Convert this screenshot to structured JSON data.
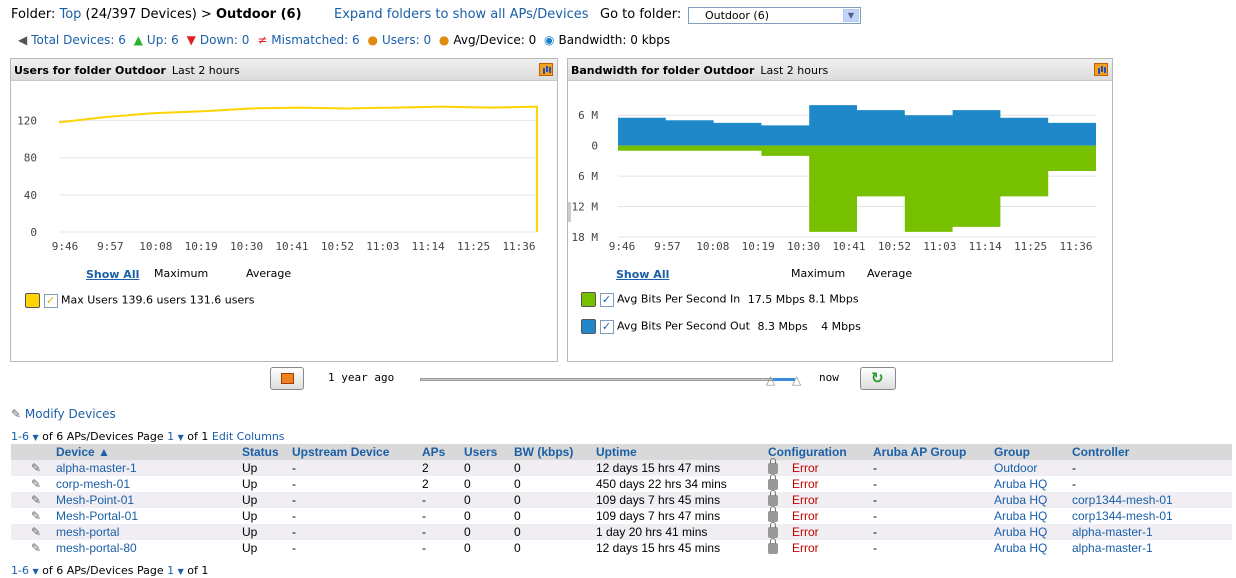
{
  "header": {
    "folder_label": "Folder:",
    "top_link": "Top",
    "top_count": "(24/397 Devices) >",
    "current_folder": "Outdoor (6)",
    "expand_link": "Expand folders to show all APs/Devices",
    "goto_label": "Go to folder:",
    "goto_value": "Outdoor (6)"
  },
  "stats": {
    "total": "Total Devices: 6",
    "up": "Up: 6",
    "down": "Down: 0",
    "mismatched": "Mismatched: 6",
    "users": "Users: 0",
    "avg": "Avg/Device: 0",
    "bandwidth": "Bandwidth: 0 kbps"
  },
  "users_panel": {
    "title": "Users for folder Outdoor",
    "range": "Last 2 hours",
    "show_all": "Show All",
    "col_max": "Maximum",
    "col_avg": "Average",
    "series_label": "Max Users",
    "series_max": "139.6 users",
    "series_avg": "131.6 users",
    "color": "#ffd400"
  },
  "bw_panel": {
    "title": "Bandwidth for folder Outdoor",
    "range": "Last 2 hours",
    "show_all": "Show All",
    "col_max": "Maximum",
    "col_avg": "Average",
    "in_label": "Avg Bits Per Second In",
    "in_max": "17.5 Mbps",
    "in_avg": "8.1 Mbps",
    "out_label": "Avg Bits Per Second Out",
    "out_max": "8.3 Mbps",
    "out_avg": "4 Mbps",
    "in_color": "#77c000",
    "out_color": "#1e88c8"
  },
  "slider": {
    "left_label": "1 year ago",
    "right_label": "now"
  },
  "chart_data": [
    {
      "type": "line",
      "x": [
        "9:46",
        "9:57",
        "10:08",
        "10:19",
        "10:30",
        "10:41",
        "10:52",
        "11:03",
        "11:14",
        "11:25",
        "11:36"
      ],
      "series": [
        {
          "name": "Max Users",
          "values": [
            118,
            124,
            128,
            130,
            133,
            134,
            133,
            134,
            135,
            134,
            135
          ]
        }
      ],
      "ylim": [
        0,
        140
      ],
      "yticks": [
        0,
        40,
        80,
        120
      ]
    },
    {
      "type": "area",
      "x": [
        "9:46",
        "9:57",
        "10:08",
        "10:19",
        "10:30",
        "10:41",
        "10:52",
        "11:03",
        "11:14",
        "11:25",
        "11:36"
      ],
      "series": [
        {
          "name": "Avg Bits Per Second Out",
          "values": [
            5.5,
            5,
            4.5,
            4,
            8,
            7,
            6,
            7,
            5.5,
            4.5,
            3.5
          ]
        },
        {
          "name": "Avg Bits Per Second In",
          "values": [
            -1,
            -1,
            -1,
            -2,
            -17,
            -10,
            -17,
            -16,
            -10,
            -5,
            -1
          ]
        }
      ],
      "ylim": [
        -18,
        9
      ],
      "ytick_labels": [
        "6 M",
        "0",
        "6 M",
        "12 M",
        "18 M"
      ]
    }
  ],
  "table": {
    "pager_top_range": "1-6",
    "pager_top_text": "of 6 APs/Devices  Page",
    "pager_page": "1",
    "pager_of": "of 1",
    "edit_columns": "Edit Columns",
    "pager_bottom_range": "1-6",
    "modify": "Modify Devices",
    "columns": [
      "Device ▲",
      "Status",
      "Upstream Device",
      "APs",
      "Users",
      "BW (kbps)",
      "Uptime",
      "Configuration",
      "Aruba AP Group",
      "Group",
      "Controller"
    ],
    "rows": [
      [
        "alpha-master-1",
        "Up",
        "-",
        "2",
        "0",
        "0",
        "12 days 15 hrs 47 mins",
        "Error",
        "-",
        "Outdoor",
        "-"
      ],
      [
        "corp-mesh-01",
        "Up",
        "-",
        "2",
        "0",
        "0",
        "450 days 22 hrs 34 mins",
        "Error",
        "-",
        "Aruba HQ",
        "-"
      ],
      [
        "Mesh-Point-01",
        "Up",
        "-",
        "-",
        "0",
        "0",
        "109 days 7 hrs 45 mins",
        "Error",
        "-",
        "Aruba HQ",
        "corp1344-mesh-01"
      ],
      [
        "Mesh-Portal-01",
        "Up",
        "-",
        "-",
        "0",
        "0",
        "109 days 7 hrs 47 mins",
        "Error",
        "-",
        "Aruba HQ",
        "corp1344-mesh-01"
      ],
      [
        "mesh-portal",
        "Up",
        "-",
        "-",
        "0",
        "0",
        "1 day 20 hrs 41 mins",
        "Error",
        "-",
        "Aruba HQ",
        "alpha-master-1"
      ],
      [
        "mesh-portal-80",
        "Up",
        "-",
        "-",
        "0",
        "0",
        "12 days 15 hrs 45 mins",
        "Error",
        "-",
        "Aruba HQ",
        "alpha-master-1"
      ]
    ]
  }
}
